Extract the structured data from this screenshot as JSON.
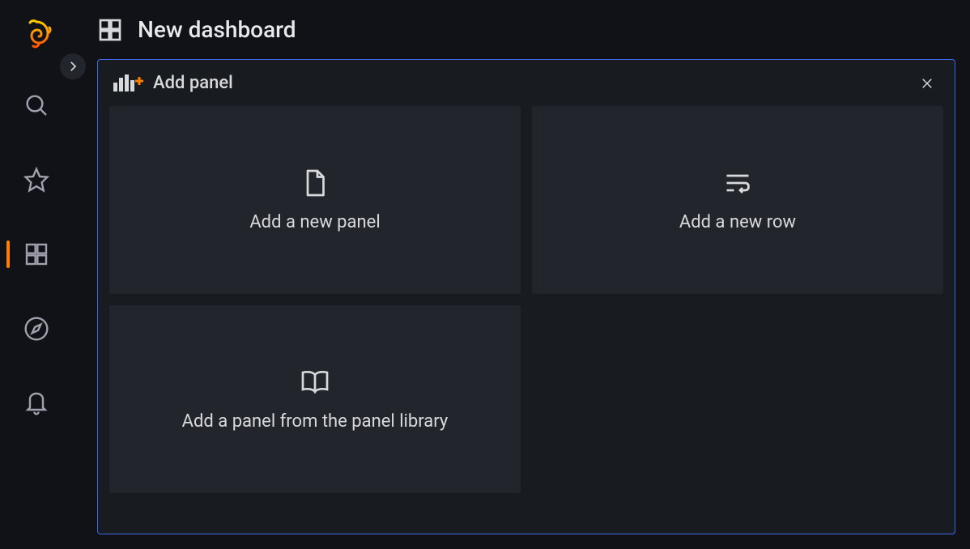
{
  "page": {
    "title": "New dashboard"
  },
  "panel": {
    "title": "Add panel",
    "options": [
      {
        "label": "Add a new panel"
      },
      {
        "label": "Add a new row"
      },
      {
        "label": "Add a panel from the panel library"
      }
    ]
  },
  "sidebar": {
    "items": [
      {
        "name": "search"
      },
      {
        "name": "favorites"
      },
      {
        "name": "dashboards",
        "active": true
      },
      {
        "name": "explore"
      },
      {
        "name": "alerts"
      }
    ]
  }
}
